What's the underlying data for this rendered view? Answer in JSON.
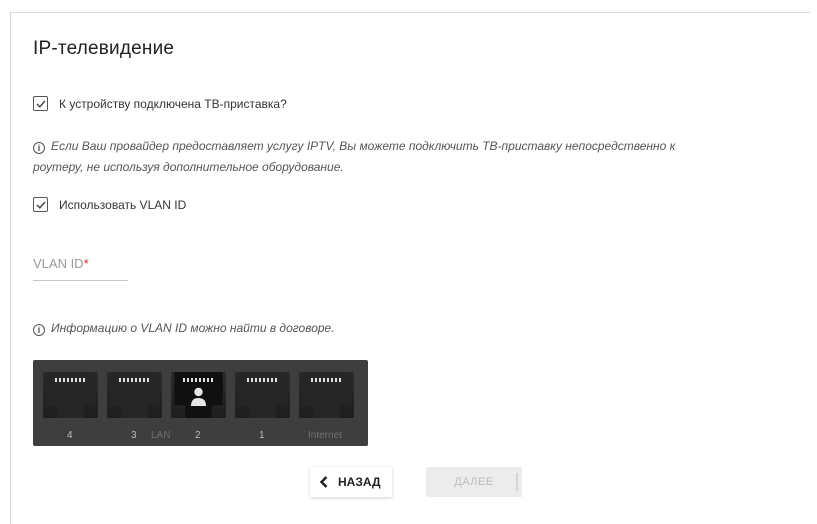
{
  "page": {
    "title": "IP-телевидение"
  },
  "stb_checkbox": {
    "label": "К устройству подключена ТВ-приставка?",
    "checked": true
  },
  "info_iptv": {
    "icon": "info-icon",
    "line1": "Если Ваш провайдер предоставляет услугу IPTV, Вы можете подключить ТВ-приставку непосредственно к",
    "line2": "роутеру, не используя дополнительное оборудование."
  },
  "vlan_checkbox": {
    "label": "Использовать VLAN ID",
    "checked": true
  },
  "vlan_field": {
    "placeholder": "VLAN ID",
    "required_mark": "*",
    "value": ""
  },
  "info_vlan": {
    "icon": "info-icon",
    "text": "Информацию о VLAN ID можно найти в договоре."
  },
  "ports": {
    "labels": [
      "4",
      "3",
      "2",
      "1",
      "Internet"
    ],
    "group_label": "LAN",
    "active_port": "2",
    "colors": {
      "panel": "#3e3e3e",
      "active_label": "#bdbdbd"
    }
  },
  "buttons": {
    "back": "НАЗАД",
    "next": "ДАЛЕЕ"
  }
}
